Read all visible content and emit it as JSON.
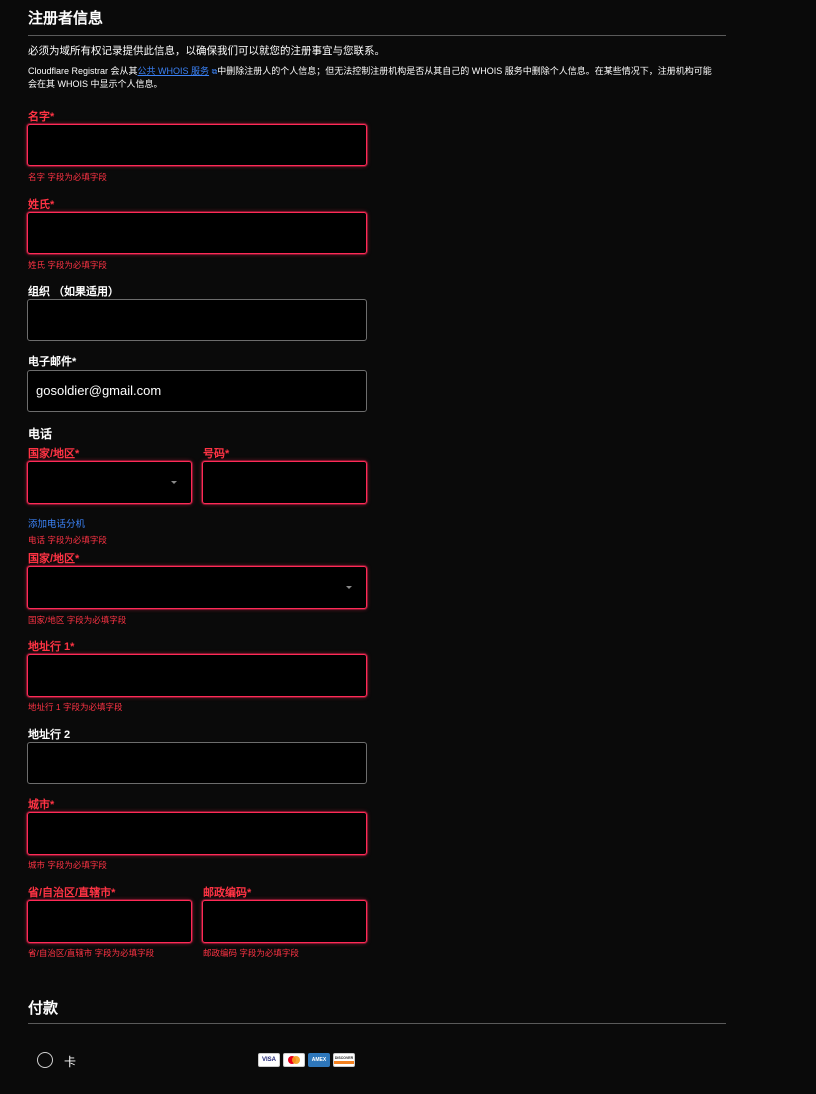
{
  "registrant": {
    "title": "注册者信息",
    "intro": "必须为域所有权记录提供此信息，以确保我们可以就您的注册事宜与您联系。",
    "whois_prefix": "Cloudflare Registrar 会从其",
    "whois_link": "公共 WHOIS 服务",
    "whois_line1_suffix": "中删除注册人的个人信息；但无法控制注册机构是否从其自己的 WHOIS 服务中删除个人信息。在某些情况下，注册机构可能",
    "whois_line2": "会在其 WHOIS 中显示个人信息。"
  },
  "fields": {
    "first_name": {
      "label": "名字*",
      "value": "",
      "error": "名字 字段为必填字段"
    },
    "last_name": {
      "label": "姓氏*",
      "value": "",
      "error": "姓氏 字段为必填字段"
    },
    "organization": {
      "label": "组织 （如果适用）",
      "value": ""
    },
    "email": {
      "label": "电子邮件*",
      "value": "gosoldier@gmail.com"
    },
    "phone": {
      "group_label": "电话",
      "country_label": "国家/地区*",
      "country_value": "",
      "number_label": "号码*",
      "number_value": "",
      "add_extension": "添加电话分机",
      "error": "电话 字段为必填字段"
    },
    "country": {
      "label": "国家/地区*",
      "value": "",
      "error": "国家/地区 字段为必填字段"
    },
    "address1": {
      "label": "地址行 1*",
      "value": "",
      "error": "地址行 1 字段为必填字段"
    },
    "address2": {
      "label": "地址行 2",
      "value": ""
    },
    "city": {
      "label": "城市*",
      "value": "",
      "error": "城市 字段为必填字段"
    },
    "state": {
      "label": "省/自治区/直辖市*",
      "value": "",
      "error": "省/自治区/直辖市 字段为必填字段"
    },
    "postal": {
      "label": "邮政编码*",
      "value": "",
      "error": "邮政编码 字段为必填字段"
    }
  },
  "payment": {
    "title": "付款",
    "card_label": "卡",
    "card_brands": [
      "VISA",
      "MC",
      "AMEX",
      "DISCOVER"
    ]
  },
  "colors": {
    "background": "#0a0a0a",
    "error": "#ff3344",
    "error_border": "#ff2a57",
    "link": "#3b82f6"
  }
}
